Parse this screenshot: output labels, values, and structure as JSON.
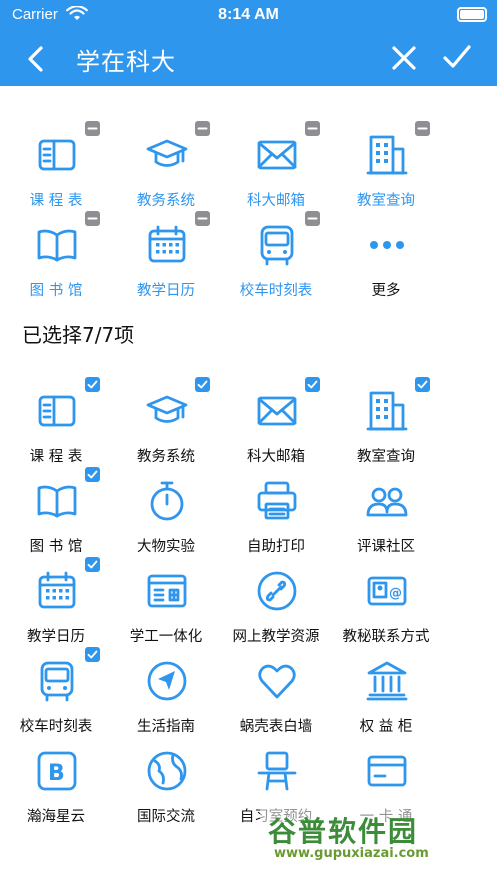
{
  "status_bar": {
    "carrier": "Carrier",
    "time": "8:14 AM"
  },
  "nav": {
    "title": "学在科大"
  },
  "colors": {
    "accent": "#2f96ee",
    "badge_gray": "#8e8e93"
  },
  "favorites": [
    {
      "label": "课 程 表",
      "icon": "timetable-icon"
    },
    {
      "label": "教务系统",
      "icon": "graduation-cap-icon"
    },
    {
      "label": "科大邮箱",
      "icon": "mail-icon"
    },
    {
      "label": "教室查询",
      "icon": "building-icon"
    },
    {
      "label": "图 书 馆",
      "icon": "book-icon"
    },
    {
      "label": "教学日历",
      "icon": "calendar-icon"
    },
    {
      "label": "校车时刻表",
      "icon": "bus-icon"
    },
    {
      "label": "更多",
      "icon": "more-icon"
    }
  ],
  "selection": {
    "text": "已选择7/7项"
  },
  "all_apps": [
    {
      "label": "课 程 表",
      "icon": "timetable-icon",
      "checked": true
    },
    {
      "label": "教务系统",
      "icon": "graduation-cap-icon",
      "checked": true
    },
    {
      "label": "科大邮箱",
      "icon": "mail-icon",
      "checked": true
    },
    {
      "label": "教室查询",
      "icon": "building-icon",
      "checked": true
    },
    {
      "label": "图 书 馆",
      "icon": "book-icon",
      "checked": true
    },
    {
      "label": "大物实验",
      "icon": "stopwatch-icon",
      "checked": false
    },
    {
      "label": "自助打印",
      "icon": "printer-icon",
      "checked": false
    },
    {
      "label": "评课社区",
      "icon": "community-icon",
      "checked": false
    },
    {
      "label": "教学日历",
      "icon": "calendar-icon",
      "checked": true
    },
    {
      "label": "学工一体化",
      "icon": "terminal-window-icon",
      "checked": false
    },
    {
      "label": "网上教学资源",
      "icon": "link-icon",
      "checked": false
    },
    {
      "label": "教秘联系方式",
      "icon": "contact-card-icon",
      "checked": false
    },
    {
      "label": "校车时刻表",
      "icon": "bus-icon",
      "checked": true
    },
    {
      "label": "生活指南",
      "icon": "navigation-icon",
      "checked": false
    },
    {
      "label": "蜗壳表白墙",
      "icon": "heart-icon",
      "checked": false
    },
    {
      "label": "权 益 柜",
      "icon": "bank-icon",
      "checked": false
    },
    {
      "label": "瀚海星云",
      "icon": "b-square-icon",
      "checked": false
    },
    {
      "label": "国际交流",
      "icon": "globe-icon",
      "checked": false
    },
    {
      "label": "自习室预约",
      "icon": "desk-icon",
      "checked": false
    },
    {
      "label": "一 卡 通",
      "icon": "credit-card-icon",
      "checked": false
    }
  ],
  "watermark": {
    "title": "谷普软件园",
    "url": "www.gupuxiazai.com"
  }
}
